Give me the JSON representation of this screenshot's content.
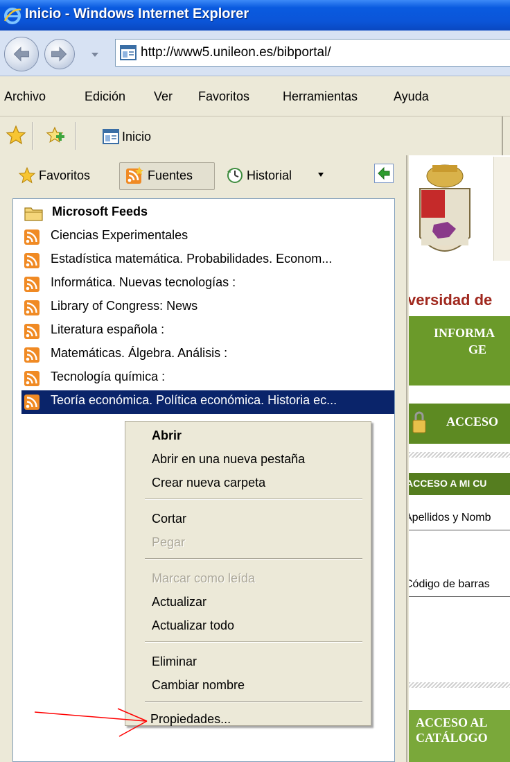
{
  "window": {
    "title": "Inicio - Windows Internet Explorer"
  },
  "address_bar": {
    "url": "http://www5.unileon.es/bibportal/"
  },
  "menu_bar": {
    "items": [
      "Archivo",
      "Edición",
      "Ver",
      "Favoritos",
      "Herramientas",
      "Ayuda"
    ]
  },
  "tab": {
    "label": "Inicio"
  },
  "favorites_center": {
    "tools": {
      "favoritos": "Favoritos",
      "fuentes": "Fuentes",
      "historial": "Historial"
    },
    "folder": "Microsoft Feeds",
    "feeds": [
      "Ciencias Experimentales",
      "Estadística matemática. Probabilidades. Econom...",
      "Informática. Nuevas tecnologías :",
      "Library of Congress: News",
      "Literatura española :",
      "Matemáticas. Álgebra. Análisis :",
      "Tecnología química :",
      "Teoría económica. Política económica. Historia ec..."
    ],
    "selected_feed": "Teoría económica. Política económica. Historia ec..."
  },
  "context_menu": {
    "open": "Abrir",
    "open_new_tab": "Abrir en una nueva pestaña",
    "new_folder": "Crear nueva carpeta",
    "cut": "Cortar",
    "paste": "Pegar",
    "mark_read": "Marcar como leída",
    "refresh": "Actualizar",
    "refresh_all": "Actualizar todo",
    "delete": "Eliminar",
    "rename": "Cambiar nombre",
    "properties": "Propiedades..."
  },
  "webpage": {
    "university": "versidad de",
    "info_line1": "INFORMA",
    "info_line2": "GE",
    "acceso": "ACCESO",
    "acceso_mi_cuenta": "ACCESO A MI CU",
    "apellidos": "Apellidos y Nomb",
    "codigo_barras": "Código de barras",
    "acceso_catalogo_1": "ACCESO AL",
    "acceso_catalogo_2": "CATÁLOGO"
  },
  "colors": {
    "titlebar": "#0b55d8",
    "selection": "#0a246a",
    "webpage_green": "#6b9a2a",
    "webpage_red_text": "#a0281e",
    "annotation_arrow": "#ff0000"
  }
}
